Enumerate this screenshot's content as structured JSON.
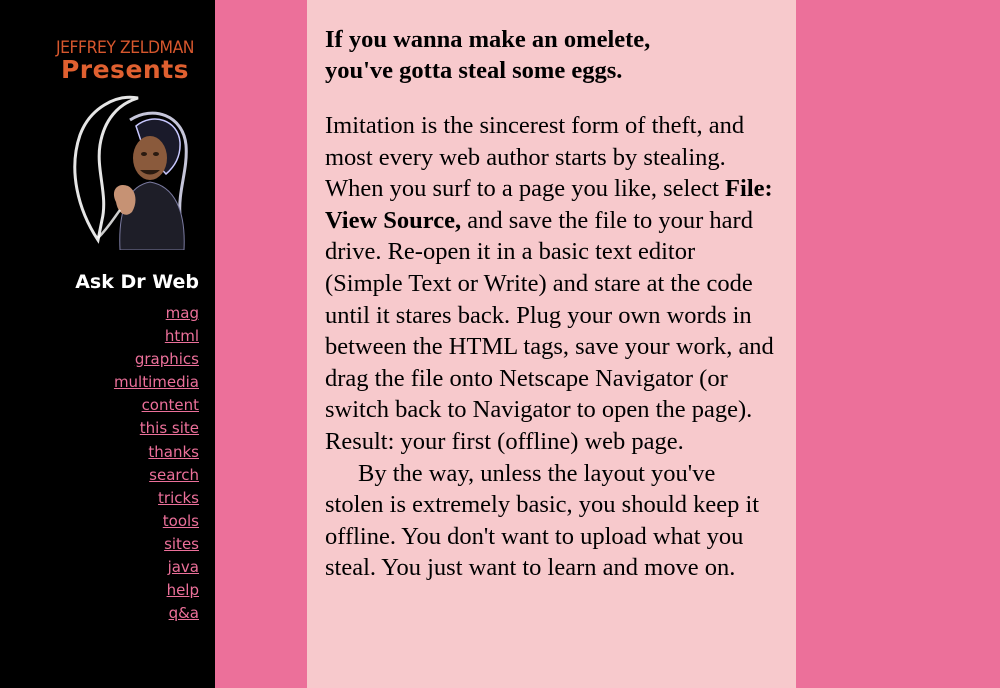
{
  "logo": {
    "name": "JEFFREY ZELDMAN",
    "presents": "Presents"
  },
  "sidebar": {
    "section_title": "Ask Dr Web",
    "nav": [
      {
        "label": "mag"
      },
      {
        "label": "html"
      },
      {
        "label": "graphics"
      },
      {
        "label": "multimedia"
      },
      {
        "label": "content"
      },
      {
        "label": "this site"
      },
      {
        "label": "thanks"
      },
      {
        "label": "search"
      },
      {
        "label": "tricks"
      },
      {
        "label": "tools"
      },
      {
        "label": "sites"
      },
      {
        "label": "java"
      },
      {
        "label": "help"
      },
      {
        "label": "q&a"
      }
    ]
  },
  "article": {
    "headline_line1": "If you wanna make an omelete,",
    "headline_line2": "you've gotta steal some eggs.",
    "p1_before": "Imitation is the sincerest form of theft, and most every web author starts by stealing. When you surf to a page you like, select ",
    "p1_bold": "File: View Source,",
    "p1_after": " and save the file to your hard drive. Re-open it in a basic text editor (Simple Text or Write) and stare at the code until it stares back. Plug your own words in between the HTML tags, save your work, and drag the file onto Netscape Navigator (or switch back to Navigator to open the page). Result: your first (offline) web page.",
    "p2": "By the way, unless the layout you've stolen is extremely basic, you should keep it offline. You don't want to upload what you steal. You just want to learn and move on."
  },
  "colors": {
    "page_background": "#ec709a",
    "sidebar_background": "#000000",
    "content_background": "#f7c9cc",
    "nav_link": "#ec709a",
    "logo_orange": "#e06030"
  }
}
